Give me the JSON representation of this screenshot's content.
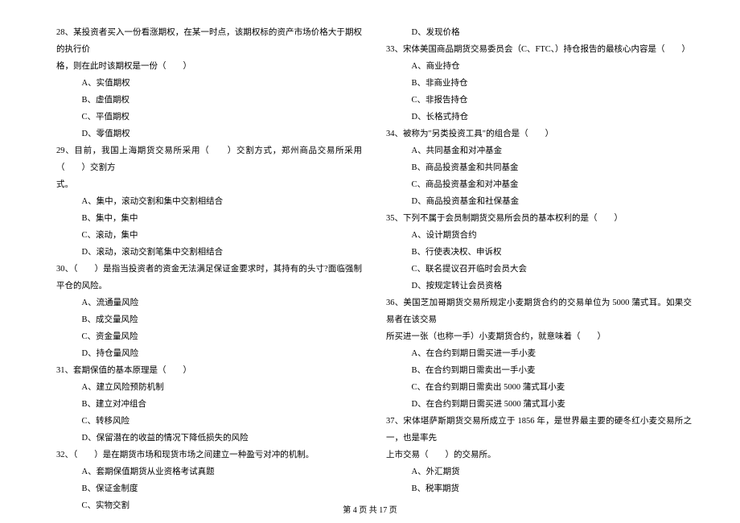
{
  "leftColumn": {
    "q28": {
      "stem1": "28、某投资者买入一份看涨期权，在某一时点，该期权标的资产市场价格大于期权的执行价",
      "stem2": "格，则在此时该期权是一份（　　）",
      "optA": "A、实值期权",
      "optB": "B、虚值期权",
      "optC": "C、平值期权",
      "optD": "D、零值期权"
    },
    "q29": {
      "stem1": "29、目前，我国上海期货交易所采用（　　）交割方式，郑州商品交易所采用（　　）交割方",
      "stem2": "式。",
      "optA": "A、集中，滚动交割和集中交割相结合",
      "optB": "B、集中，集中",
      "optC": "C、滚动，集中",
      "optD": "D、滚动，滚动交割笔集中交割相结合"
    },
    "q30": {
      "stem": "30、（　　）是指当投资者的资金无法满足保证金要求时，其持有的头寸?面临强制平仓的风险。",
      "optA": "A、流通量风险",
      "optB": "B、成交量风险",
      "optC": "C、资金量风险",
      "optD": "D、持仓量风险"
    },
    "q31": {
      "stem": "31、套期保值的基本原理是（　　）",
      "optA": "A、建立风险预防机制",
      "optB": "B、建立对冲组合",
      "optC": "C、转移风险",
      "optD": "D、保留潜在的收益的情况下降低损失的风险"
    },
    "q32": {
      "stem": "32、（　　）是在期货市场和现货市场之间建立一种盈亏对冲的机制。",
      "optA": "A、套期保值期货从业资格考试真题",
      "optB": "B、保证金制度",
      "optC": "C、实物交割"
    }
  },
  "rightColumn": {
    "q32_optD": "D、发现价格",
    "q33": {
      "stem": "33、宋体美国商品期货交易委员会（C、FTC、）持仓报告的最核心内容是（　　）",
      "optA": "A、商业持仓",
      "optB": "B、非商业持仓",
      "optC": "C、非报告持仓",
      "optD": "D、长格式持仓"
    },
    "q34": {
      "stem": "34、被称为\"另类投资工具\"的组合是（　　）",
      "optA": "A、共同基金和对冲基金",
      "optB": "B、商品投资基金和共同基金",
      "optC": "C、商品投资基金和对冲基金",
      "optD": "D、商品投资基金和社保基金"
    },
    "q35": {
      "stem": "35、下列不属于会员制期货交易所会员的基本权利的是（　　）",
      "optA": "A、设计期货合约",
      "optB": "B、行使表决权、申诉权",
      "optC": "C、联名提议召开临时会员大会",
      "optD": "D、按规定转让会员资格"
    },
    "q36": {
      "stem1": "36、美国芝加哥期货交易所规定小麦期货合约的交易单位为 5000 蒲式耳。如果交易者在该交易",
      "stem2": "所买进一张（也称一手）小麦期货合约，就意味着（　　）",
      "optA": "A、在合约到期日需买进一手小麦",
      "optB": "B、在合约到期日需卖出一手小麦",
      "optC": "C、在合约到期日需卖出 5000 蒲式耳小麦",
      "optD": "D、在合约到期日需买进 5000 蒲式耳小麦"
    },
    "q37": {
      "stem1": "37、宋体堪萨斯期货交易所成立于 1856 年，是世界最主要的硬冬红小麦交易所之一，也是率先",
      "stem2": "上市交易（　　）的交易所。",
      "optA": "A、外汇期货",
      "optB": "B、税率期货"
    }
  },
  "footer": "第 4 页 共 17 页"
}
